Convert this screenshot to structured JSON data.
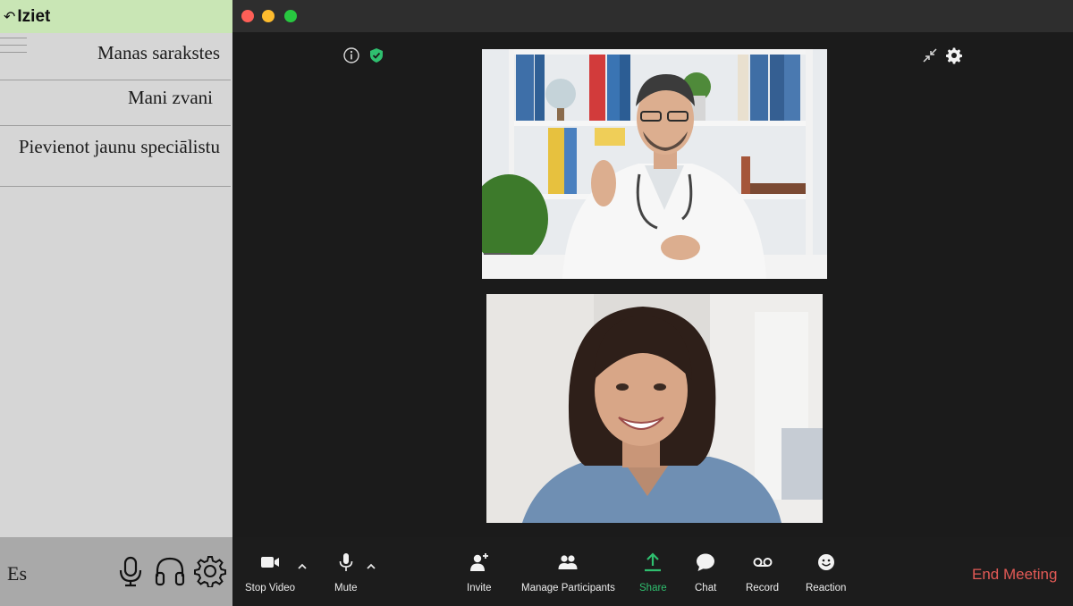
{
  "sidebar": {
    "exit_label": "Iziet",
    "menu": [
      {
        "label": "Manas sarakstes"
      },
      {
        "label": "Mani zvani"
      },
      {
        "label": "Pievienot jaunu speciālistu"
      }
    ],
    "user_initials": "Es",
    "bottom_icons": [
      "microphone-icon",
      "headphones-icon",
      "gear-icon"
    ]
  },
  "window": {
    "top_left_icons": [
      "info-icon",
      "shield-check-icon"
    ],
    "top_right_icons": [
      "collapse-arrows-icon",
      "settings-icon"
    ],
    "participants": [
      {
        "type": "video",
        "depicts": "doctor-video-tile"
      },
      {
        "type": "video",
        "depicts": "patient-video-tile"
      }
    ]
  },
  "toolbar": {
    "stop_video": "Stop Video",
    "mute": "Mute",
    "invite": "Invite",
    "manage_participants": "Manage Participants",
    "share": "Share",
    "chat": "Chat",
    "record": "Record",
    "reaction": "Reaction",
    "end_meeting": "End Meeting"
  },
  "colors": {
    "exit_bar": "#c9e6b5",
    "sidebar": "#d6d6d6",
    "sidebar_bottom": "#a9a9a9",
    "share_accent": "#2fbf6f",
    "end_meeting": "#e35a56"
  }
}
